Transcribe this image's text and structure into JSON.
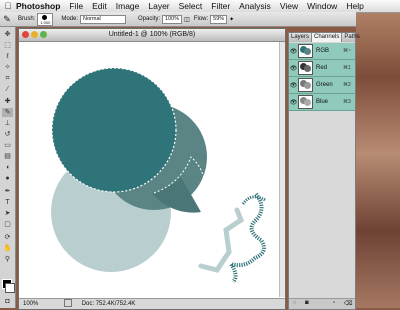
{
  "menubar": {
    "apple": "",
    "app": "Photoshop",
    "items": [
      "File",
      "Edit",
      "Image",
      "Layer",
      "Select",
      "Filter",
      "Analysis",
      "View",
      "Window",
      "Help"
    ]
  },
  "options": {
    "brush_label": "Brush:",
    "brush_size": "1.000",
    "mode_label": "Mode:",
    "mode_value": "Normal",
    "opacity_label": "Opacity:",
    "opacity_value": "100%",
    "flow_label": "Flow:",
    "flow_value": "59%"
  },
  "document": {
    "title": "Untitled-1 @ 100% (RGB/8)",
    "zoom": "100%",
    "doc_info": "Doc: 752.4K/752.4K"
  },
  "panel": {
    "tabs": [
      "Layers",
      "Channels ×",
      "Paths"
    ],
    "channels": [
      {
        "name": "RGB",
        "key": "⌘~"
      },
      {
        "name": "Red",
        "key": "⌘1"
      },
      {
        "name": "Green",
        "key": "⌘2"
      },
      {
        "name": "Blue",
        "key": "⌘3"
      }
    ]
  },
  "colors": {
    "teal_dark": "#2f7479",
    "teal_mid": "#5b8485",
    "teal_light": "#b9cfcf",
    "channel_highlight": "#8fcabc"
  }
}
